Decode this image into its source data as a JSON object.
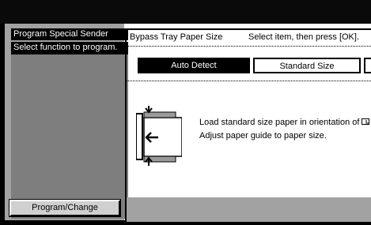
{
  "left_panel": {
    "title": "Program Special Sender",
    "subtitle": "Select function to program.",
    "button_label": "Program/Change"
  },
  "right_panel": {
    "title": "Bypass Tray Paper Size",
    "instruction": "Select item, then press [OK].",
    "options": [
      {
        "label": "Auto Detect",
        "selected": true
      },
      {
        "label": "Standard Size",
        "selected": false
      },
      {
        "label": "",
        "selected": false
      }
    ],
    "message_line1": "Load standard size paper in orientation of",
    "message_line2": "Adjust paper guide to paper size."
  },
  "icons": {
    "orientation": "landscape-paper-icon",
    "diagram": "bypass-tray-paper-guide-icon"
  }
}
